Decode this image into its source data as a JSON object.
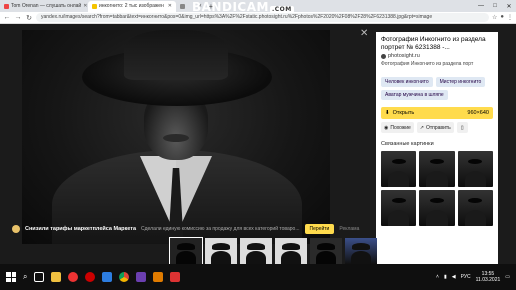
{
  "browser": {
    "tabs": [
      {
        "title": "Tom Orenan — слушать онлай",
        "favicon_color": "#e44",
        "active": false
      },
      {
        "title": "инкогнито: 2 тыс изображен",
        "favicon_color": "#f5c400",
        "active": true
      },
      {
        "title": "",
        "favicon_color": "#888",
        "active": false
      }
    ],
    "new_tab": "+",
    "url": "yandex.ru/images/search?from=tabbar&text=инкогнито&pos=0&img_url=https%3A%2F%2Fstatic.photosight.ru%2Fphotos%2F2020%2F08%2F28%2F6231388.jpg&rpt=simage",
    "window_controls": [
      "—",
      "□",
      "✕"
    ]
  },
  "watermark": {
    "brand": "BANDICAM",
    "suffix": ".COM"
  },
  "image_viewer": {
    "close_label": "✕"
  },
  "panel": {
    "title": "Фотография Инкогнито из раздела портрет № 6231388 -...",
    "site": "photosight.ru",
    "description": "Фотография Инкогнито из раздела порт",
    "tags": [
      "Человек инкогнито",
      "Мистер инкогнито",
      "Аватар мужчина в шляпе"
    ],
    "open_label": "Открыть",
    "size": "960×640",
    "similar_label": "Похожие",
    "share_label": "Отправить",
    "related_heading": "Связанные картинки"
  },
  "ad": {
    "title": "Снизили тарифы маркетплейса Маркета",
    "text": "Сделали единую комиссию за продажу для всех категорий товаро...",
    "button": "Перейти",
    "label": "Реклама"
  },
  "taskbar": {
    "tray_lang": "РУС",
    "time": "13:55",
    "date": "11.03.2021"
  }
}
